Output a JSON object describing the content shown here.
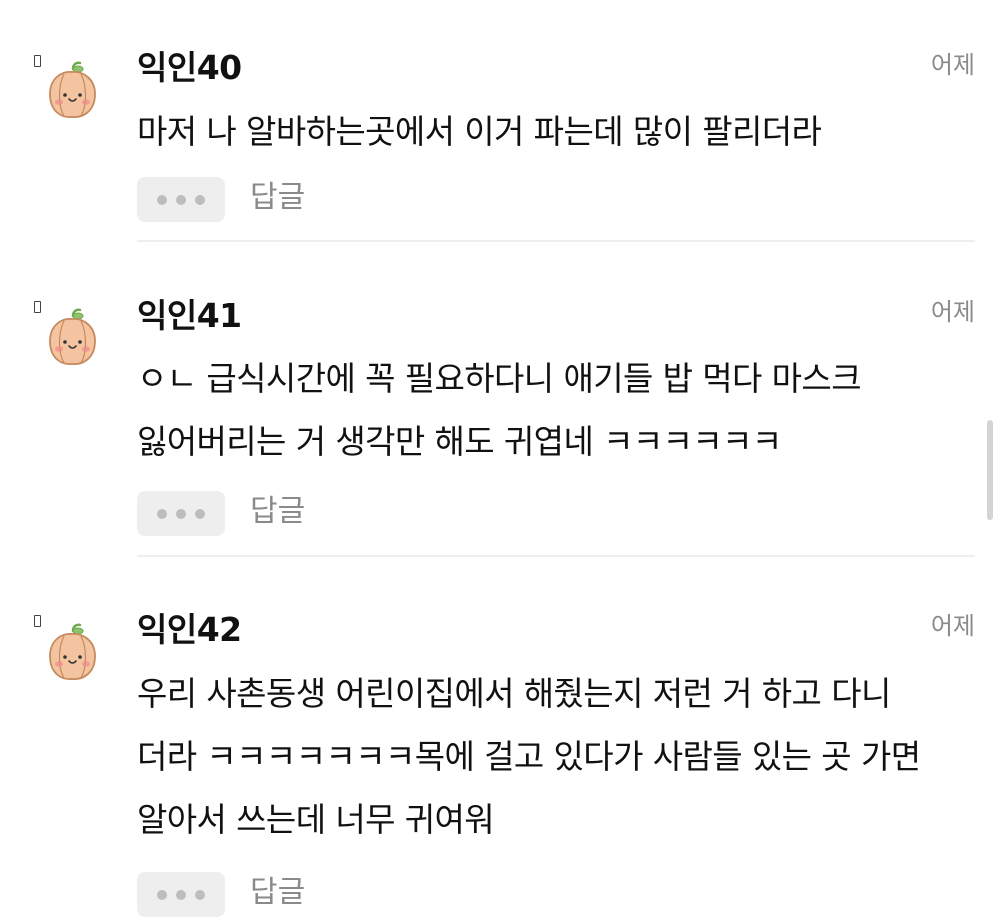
{
  "comments": [
    {
      "author": "익인40",
      "time": "어제",
      "lines": [
        "마저 나 알바하는곳에서 이거 파는데 많이 팔리더라"
      ],
      "reply_label": "답글"
    },
    {
      "author": "익인41",
      "time": "어제",
      "lines": [
        "ㅇㄴ 급식시간에 꼭 필요하다니 애기들 밥 먹다 마스크",
        "잃어버리는 거 생각만 해도 귀엽네 ㅋㅋㅋㅋㅋㅋ"
      ],
      "reply_label": "답글"
    },
    {
      "author": "익인42",
      "time": "어제",
      "lines": [
        "우리 사촌동생 어린이집에서 해줬는지 저런 거 하고 다니",
        "더라 ㅋㅋㅋㅋㅋㅋㅋ목에 걸고 있다가 사람들 있는 곳 가면",
        "알아서 쓰는데 너무 귀여워"
      ],
      "reply_label": "답글"
    }
  ],
  "icons": {
    "avatar": "pumpkin-avatar-icon",
    "more": "more-dots-icon",
    "mark": "badge-mark-icon"
  },
  "colors": {
    "time": "#8a8a8a",
    "reply": "#8a8a8a",
    "more_bg": "#eeeeee",
    "dot": "#bdbdbd",
    "pumpkin": "#f4c4a0",
    "pumpkin_outline": "#c58a5e",
    "stem": "#8cc46c",
    "cheek": "#f08a8a"
  }
}
